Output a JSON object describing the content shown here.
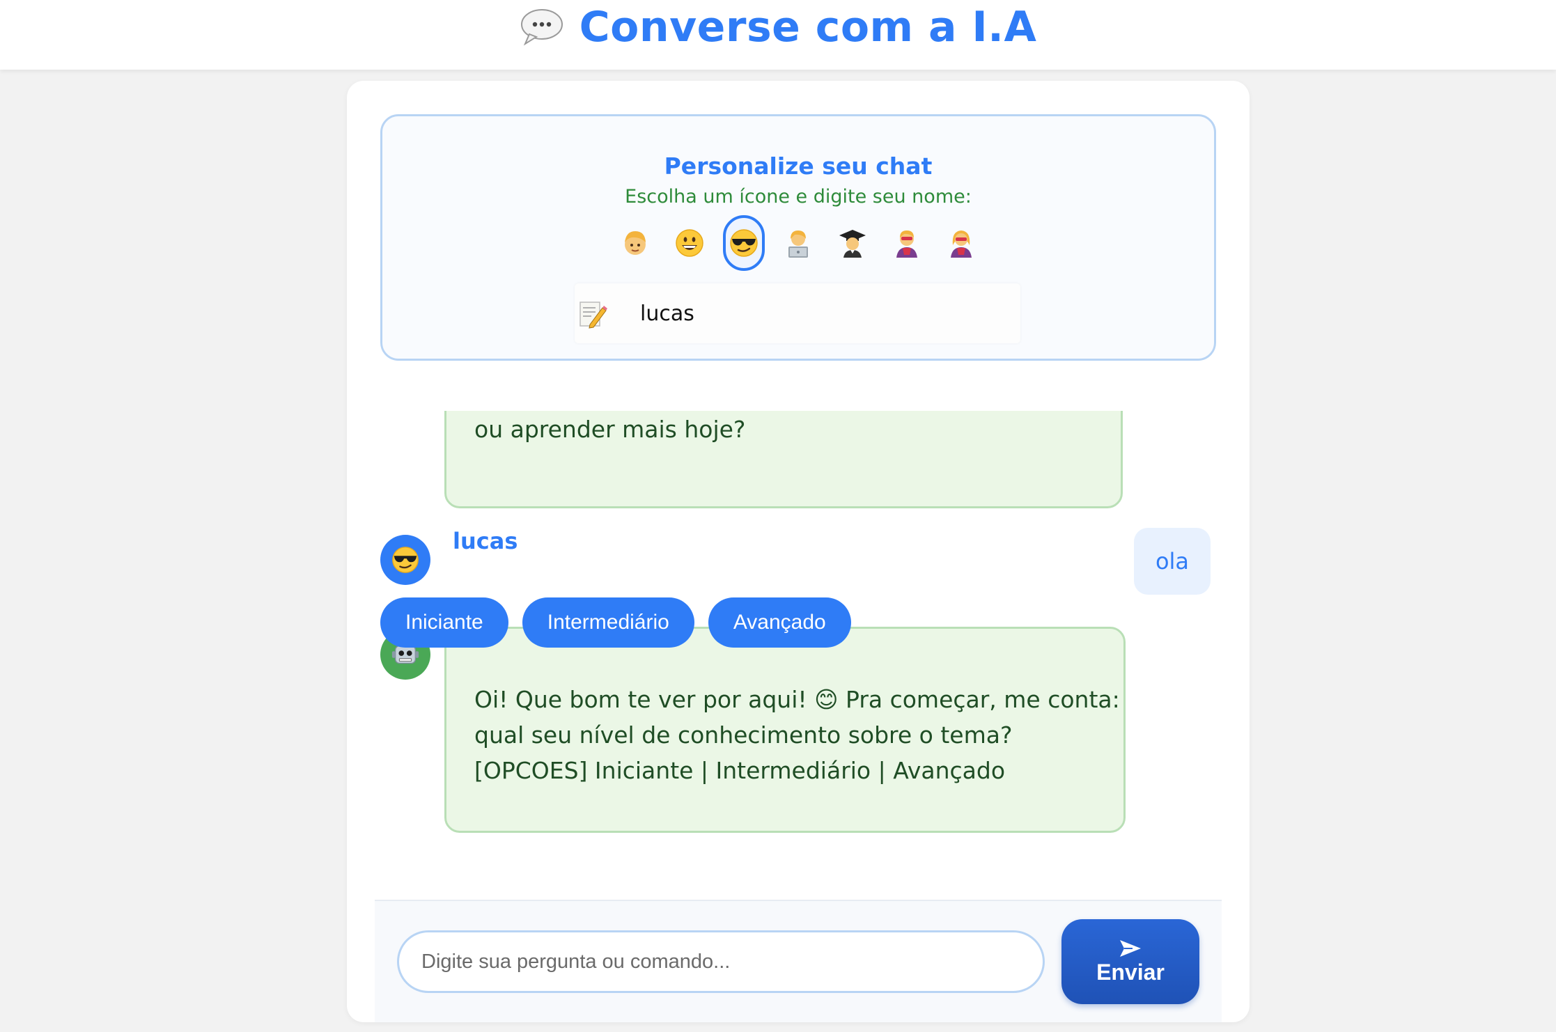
{
  "header": {
    "title": "Converse com a I.A",
    "title_icon": "speech-bubble-icon"
  },
  "personalize": {
    "title": "Personalize seu chat",
    "subtitle": "Escolha um ícone e digite seu nome:",
    "icons": [
      {
        "name": "person-blond-icon",
        "selected": false
      },
      {
        "name": "grinning-face-icon",
        "selected": false
      },
      {
        "name": "sunglasses-face-icon",
        "selected": true
      },
      {
        "name": "technologist-icon",
        "selected": false
      },
      {
        "name": "student-icon",
        "selected": false
      },
      {
        "name": "superhero-icon",
        "selected": false
      },
      {
        "name": "superhero-woman-icon",
        "selected": false
      }
    ],
    "name_field_icon": "memo-pencil-icon",
    "name_value": "lucas"
  },
  "chat": {
    "messages": [
      {
        "role": "bot",
        "text": "ou aprender mais hoje?"
      },
      {
        "role": "user",
        "author": "lucas",
        "text": "ola"
      },
      {
        "role": "bot",
        "lines": [
          "Oi! Que bom te ver por aqui! 😊 Pra começar, me conta:",
          "qual seu nível de conhecimento sobre o tema?",
          "[OPCOES] Iniciante | Intermediário | Avançado"
        ]
      }
    ],
    "options": [
      "Iniciante",
      "Intermediário",
      "Avançado"
    ]
  },
  "input": {
    "placeholder": "Digite sua pergunta ou comando...",
    "send_label": "Enviar"
  },
  "colors": {
    "accent": "#2f7cf6",
    "bot_bubble": "#ebf7e6",
    "bot_text": "#1f4d25",
    "user_bubble": "#e8f1fe",
    "send_button": "#1f52b6"
  }
}
